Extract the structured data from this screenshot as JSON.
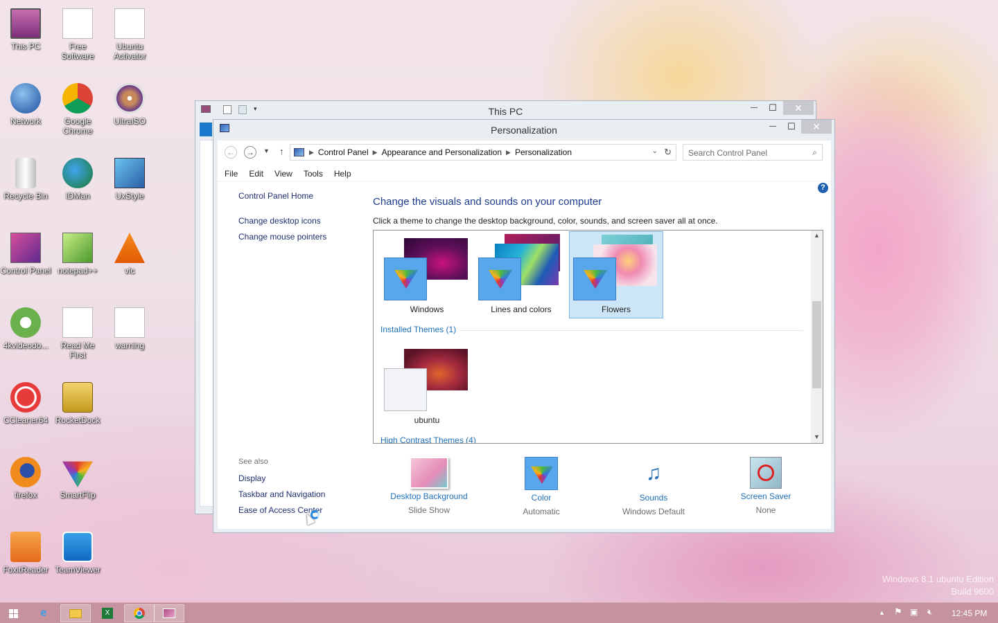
{
  "desktop": {
    "icons": [
      {
        "label": "This PC"
      },
      {
        "label": "Free Software"
      },
      {
        "label": "Ubuntu Activator"
      },
      {
        "label": "Network"
      },
      {
        "label": "Google Chrome"
      },
      {
        "label": "UltraISO"
      },
      {
        "label": "Recycle Bin"
      },
      {
        "label": "IDMan"
      },
      {
        "label": "UxStyle"
      },
      {
        "label": "Control Panel"
      },
      {
        "label": "notepad++"
      },
      {
        "label": "vlc"
      },
      {
        "label": "4kvideodo..."
      },
      {
        "label": "Read Me First"
      },
      {
        "label": "warning"
      },
      {
        "label": "CCleaner64"
      },
      {
        "label": "RocketDock"
      },
      {
        "label": "firefox"
      },
      {
        "label": "SmartFlip"
      },
      {
        "label": "FoxitReader"
      },
      {
        "label": "TeamViewer"
      }
    ],
    "watermark_line1": "Windows 8.1 ubuntu Edition",
    "watermark_line2": "Build 9600"
  },
  "back_window": {
    "title": "This PC",
    "minimize": "—",
    "maximize": "☐",
    "close": "✕"
  },
  "window": {
    "title": "Personalization",
    "minimize": "—",
    "maximize": "☐",
    "close": "✕"
  },
  "address": {
    "crumbs": [
      "Control Panel",
      "Appearance and Personalization",
      "Personalization"
    ],
    "search_placeholder": "Search Control Panel"
  },
  "menu": [
    "File",
    "Edit",
    "View",
    "Tools",
    "Help"
  ],
  "sidebar": {
    "home": "Control Panel Home",
    "links": [
      "Change desktop icons",
      "Change mouse pointers"
    ],
    "see_also": "See also",
    "see_also_links": [
      "Display",
      "Taskbar and Navigation",
      "Ease of Access Center"
    ]
  },
  "main": {
    "heading": "Change the visuals and sounds on your computer",
    "subtext": "Click a theme to change the desktop background, color, sounds, and screen saver all at once.",
    "themes": [
      {
        "name": "Windows"
      },
      {
        "name": "Lines and colors"
      },
      {
        "name": "Flowers",
        "selected": true
      }
    ],
    "installed_header": "Installed Themes (1)",
    "installed": [
      {
        "name": "ubuntu"
      }
    ],
    "high_contrast_header": "High Contrast Themes (4)"
  },
  "bottom": [
    {
      "label": "Desktop Background",
      "value": "Slide Show"
    },
    {
      "label": "Color",
      "value": "Automatic"
    },
    {
      "label": "Sounds",
      "value": "Windows Default"
    },
    {
      "label": "Screen Saver",
      "value": "None"
    }
  ],
  "taskbar": {
    "clock": "12:45 PM"
  },
  "colors": {
    "accent": "#1d6fb8",
    "selected_bg": "#cde6f7",
    "taskbar": "#c4939f"
  }
}
